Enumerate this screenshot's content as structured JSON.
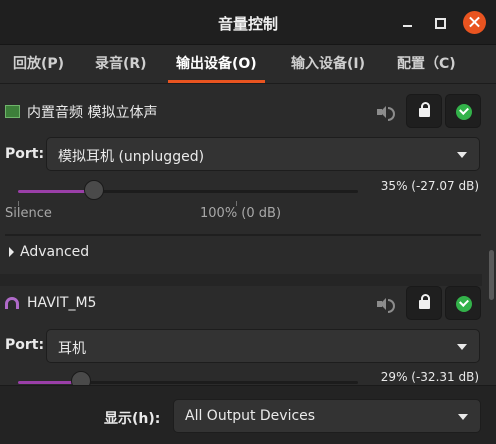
{
  "window": {
    "title": "音量控制"
  },
  "tabs": [
    {
      "label": "回放(P)"
    },
    {
      "label": "录音(R)"
    },
    {
      "label": "输出设备(O)",
      "active": true
    },
    {
      "label": "输入设备(I)"
    },
    {
      "label": "配置（C)"
    }
  ],
  "devices": [
    {
      "name": "内置音频 模拟立体声",
      "icon": "sound-card-icon",
      "port_label": "Port:",
      "port_value": "模拟耳机 (unplugged)",
      "volume_percent": 35,
      "volume_text": "35% (-27.07 dB)",
      "scale_silence": "Silence",
      "scale_100": "100% (0 dB)",
      "advanced_label": "Advanced",
      "locked": true,
      "is_default": true,
      "accent": "#9a3fa8"
    },
    {
      "name": "HAVIT_M5",
      "icon": "headphones-icon",
      "port_label": "Port:",
      "port_value": "耳机",
      "volume_percent": 29,
      "volume_text": "29% (-32.31 dB)",
      "locked": true,
      "is_default": true
    }
  ],
  "footer": {
    "show_label": "显示(h):",
    "show_value": "All Output Devices"
  },
  "colors": {
    "accent": "#e95420",
    "slider_fill": "#9a3fa8",
    "default_check": "#33b24a"
  }
}
